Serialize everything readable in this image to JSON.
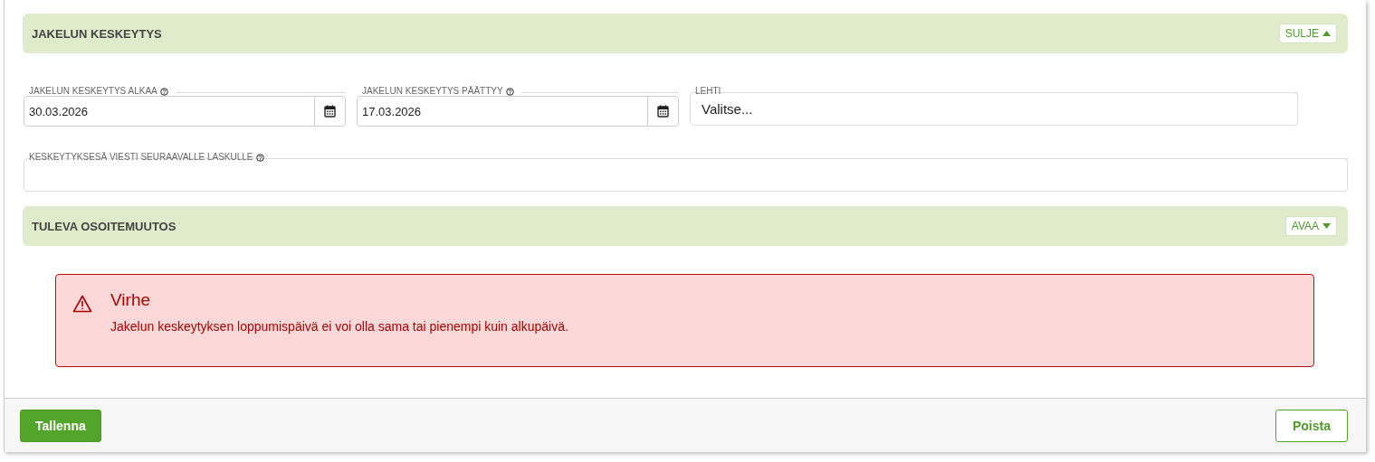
{
  "sections": [
    {
      "title": "JAKELUN KESKEYTYS",
      "toggle": "SULJE",
      "expanded": true,
      "fields": [
        {
          "kind": "date",
          "label": "JAKELUN KESKEYTYS ALKAA",
          "help": true,
          "value": "30.03.2026"
        },
        {
          "kind": "date",
          "label": "JAKELUN KESKEYTYS PÄÄTTYY",
          "help": true,
          "value": "17.03.2026"
        },
        {
          "kind": "select",
          "label": "LEHTI",
          "help": false,
          "value": "Valitse..."
        }
      ],
      "message_field": {
        "label": "KESKEYTYKSESÄ VIESTI SEURAAVALLE LASKULLE",
        "help": true
      }
    },
    {
      "title": "TULEVA OSOITEMUUTOS",
      "toggle": "AVAA",
      "expanded": false
    }
  ],
  "error": {
    "title": "Virhe",
    "message": "Jakelun keskeytyksen loppumispäivä ei voi olla sama tai pienempi kuin alkupäivä."
  },
  "footer": {
    "save": "Tallenna",
    "delete": "Poista"
  }
}
